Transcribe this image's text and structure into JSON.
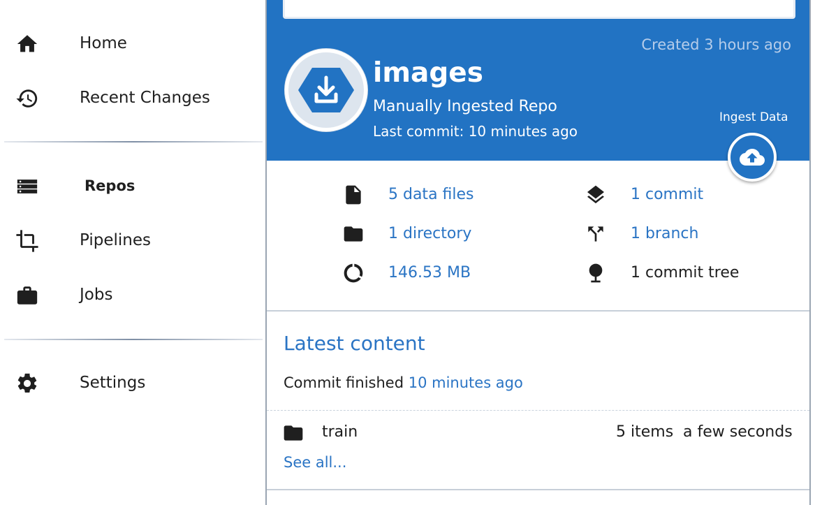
{
  "sidebar": {
    "items": [
      {
        "label": "Home",
        "icon": "home-icon"
      },
      {
        "label": "Recent Changes",
        "icon": "history-icon"
      },
      {
        "label": "Repos",
        "icon": "repos-list-icon",
        "active": true
      },
      {
        "label": "Pipelines",
        "icon": "crop-pipeline-icon"
      },
      {
        "label": "Jobs",
        "icon": "briefcase-icon"
      },
      {
        "label": "Settings",
        "icon": "gear-icon"
      }
    ]
  },
  "repo": {
    "created": "Created 3 hours ago",
    "name": "images",
    "subtitle": "Manually Ingested Repo",
    "last_commit": "Last commit: 10 minutes ago",
    "ingest_label": "Ingest Data",
    "header_color": "#2273c3",
    "link_color": "#2a74c4"
  },
  "stats": {
    "data_files": "5 data files",
    "directories": "1 directory",
    "size": "146.53 MB",
    "commits": "1 commit",
    "branches": "1 branch",
    "commit_tree": "1 commit tree"
  },
  "latest": {
    "title": "Latest content",
    "commit_prefix": "Commit finished",
    "commit_time": "10 minutes ago",
    "files": [
      {
        "name": "train",
        "items": "5 items",
        "age": "a few seconds"
      }
    ],
    "see_all": "See all..."
  }
}
